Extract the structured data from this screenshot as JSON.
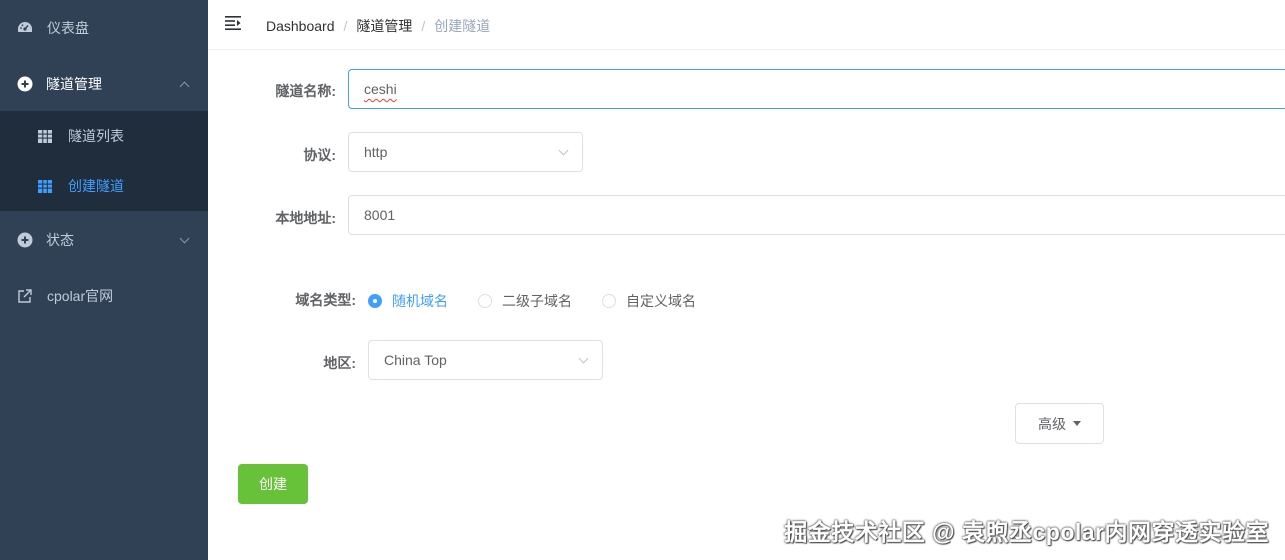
{
  "sidebar": {
    "dashboard": {
      "label": "仪表盘",
      "icon": "dashboard-icon"
    },
    "tunnel_mgmt": {
      "label": "隧道管理",
      "icon": "plus-circle-icon"
    },
    "tunnel_sub": [
      {
        "label": "隧道列表",
        "icon": "table-icon"
      },
      {
        "label": "创建隧道",
        "icon": "table-icon"
      }
    ],
    "status": {
      "label": "状态",
      "icon": "plus-circle-icon"
    },
    "official": {
      "label": "cpolar官网",
      "icon": "external-link-icon"
    }
  },
  "breadcrumb": {
    "home": "Dashboard",
    "section": "隧道管理",
    "current": "创建隧道",
    "separator": "/"
  },
  "form": {
    "name_label": "隧道名称:",
    "name_value": "ceshi",
    "protocol_label": "协议:",
    "protocol_value": "http",
    "local_label": "本地地址:",
    "local_value": "8001",
    "domain_type_label": "域名类型:",
    "domain_options": [
      "随机域名",
      "二级子域名",
      "自定义域名"
    ],
    "domain_selected": "随机域名",
    "region_label": "地区:",
    "region_value": "China Top",
    "advanced_label": "高级",
    "create_label": "创建"
  },
  "watermark": "掘金技术社区 @ 袁煦丞cpolar内网穿透实验室",
  "colors": {
    "sidebar_bg": "#304156",
    "submenu_bg": "#1f2d3d",
    "active": "#409eff",
    "create_button": "#67c23a"
  }
}
